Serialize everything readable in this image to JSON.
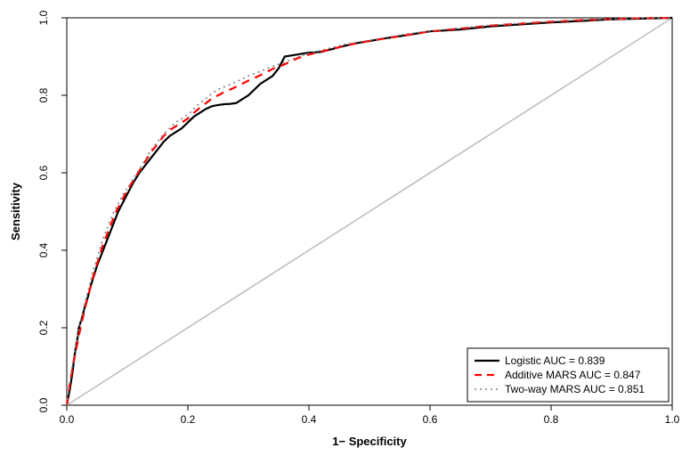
{
  "chart_data": {
    "type": "line",
    "title": "",
    "xlabel": "1− Specificity",
    "ylabel": "Sensitivity",
    "xlim": [
      0.0,
      1.0
    ],
    "ylim": [
      0.0,
      1.0
    ],
    "x_ticks": [
      0.0,
      0.2,
      0.4,
      0.6,
      0.8,
      1.0
    ],
    "y_ticks": [
      0.0,
      0.2,
      0.4,
      0.6,
      0.8,
      1.0
    ],
    "diagonal": {
      "x": [
        0.0,
        1.0
      ],
      "y": [
        0.0,
        1.0
      ]
    },
    "series": [
      {
        "name": "Logistic AUC = 0.839",
        "style": "solid",
        "color": "#000000",
        "x": [
          0.0,
          0.005,
          0.01,
          0.012,
          0.015,
          0.018,
          0.02,
          0.025,
          0.03,
          0.035,
          0.04,
          0.045,
          0.05,
          0.055,
          0.06,
          0.065,
          0.07,
          0.075,
          0.08,
          0.085,
          0.09,
          0.095,
          0.1,
          0.11,
          0.12,
          0.13,
          0.14,
          0.15,
          0.16,
          0.17,
          0.18,
          0.19,
          0.2,
          0.21,
          0.22,
          0.23,
          0.24,
          0.25,
          0.26,
          0.27,
          0.28,
          0.29,
          0.3,
          0.32,
          0.34,
          0.35,
          0.36,
          0.38,
          0.4,
          0.42,
          0.44,
          0.46,
          0.48,
          0.5,
          0.53,
          0.56,
          0.6,
          0.65,
          0.7,
          0.75,
          0.8,
          0.85,
          0.9,
          0.95,
          1.0
        ],
        "y": [
          0.0,
          0.04,
          0.09,
          0.12,
          0.15,
          0.175,
          0.2,
          0.225,
          0.255,
          0.28,
          0.31,
          0.335,
          0.36,
          0.38,
          0.4,
          0.42,
          0.44,
          0.46,
          0.48,
          0.5,
          0.515,
          0.53,
          0.545,
          0.575,
          0.6,
          0.62,
          0.64,
          0.66,
          0.68,
          0.695,
          0.705,
          0.715,
          0.73,
          0.745,
          0.755,
          0.765,
          0.772,
          0.775,
          0.777,
          0.778,
          0.78,
          0.79,
          0.8,
          0.83,
          0.85,
          0.87,
          0.9,
          0.905,
          0.91,
          0.912,
          0.92,
          0.928,
          0.935,
          0.94,
          0.948,
          0.955,
          0.965,
          0.97,
          0.978,
          0.983,
          0.988,
          0.992,
          0.996,
          0.998,
          1.0
        ]
      },
      {
        "name": "Additive MARS AUC = 0.847",
        "style": "dashed",
        "color": "#ff0000",
        "x": [
          0.0,
          0.005,
          0.01,
          0.015,
          0.02,
          0.025,
          0.03,
          0.035,
          0.04,
          0.045,
          0.05,
          0.055,
          0.06,
          0.065,
          0.07,
          0.075,
          0.08,
          0.085,
          0.09,
          0.095,
          0.1,
          0.11,
          0.12,
          0.13,
          0.14,
          0.15,
          0.16,
          0.17,
          0.18,
          0.19,
          0.2,
          0.21,
          0.22,
          0.23,
          0.24,
          0.25,
          0.26,
          0.27,
          0.28,
          0.29,
          0.3,
          0.32,
          0.34,
          0.36,
          0.38,
          0.4,
          0.42,
          0.44,
          0.46,
          0.48,
          0.5,
          0.53,
          0.56,
          0.6,
          0.65,
          0.7,
          0.75,
          0.8,
          0.85,
          0.9,
          0.95,
          1.0
        ],
        "y": [
          0.0,
          0.055,
          0.1,
          0.14,
          0.18,
          0.215,
          0.25,
          0.28,
          0.31,
          0.34,
          0.365,
          0.39,
          0.415,
          0.435,
          0.455,
          0.475,
          0.495,
          0.51,
          0.525,
          0.54,
          0.555,
          0.58,
          0.605,
          0.63,
          0.655,
          0.675,
          0.695,
          0.71,
          0.72,
          0.73,
          0.74,
          0.755,
          0.768,
          0.78,
          0.792,
          0.8,
          0.808,
          0.815,
          0.822,
          0.83,
          0.838,
          0.852,
          0.868,
          0.88,
          0.895,
          0.905,
          0.913,
          0.92,
          0.928,
          0.935,
          0.94,
          0.948,
          0.955,
          0.965,
          0.972,
          0.98,
          0.985,
          0.99,
          0.994,
          0.997,
          0.999,
          1.0
        ]
      },
      {
        "name": "Two-way MARS AUC = 0.851",
        "style": "dotted",
        "color": "#808080",
        "x": [
          0.0,
          0.005,
          0.01,
          0.015,
          0.02,
          0.025,
          0.03,
          0.035,
          0.04,
          0.045,
          0.05,
          0.055,
          0.06,
          0.065,
          0.07,
          0.075,
          0.08,
          0.085,
          0.09,
          0.095,
          0.1,
          0.11,
          0.12,
          0.13,
          0.14,
          0.15,
          0.16,
          0.17,
          0.18,
          0.19,
          0.2,
          0.21,
          0.22,
          0.23,
          0.24,
          0.25,
          0.26,
          0.27,
          0.28,
          0.3,
          0.32,
          0.34,
          0.36,
          0.38,
          0.4,
          0.42,
          0.44,
          0.46,
          0.48,
          0.5,
          0.53,
          0.56,
          0.6,
          0.65,
          0.7,
          0.75,
          0.8,
          0.85,
          0.9,
          0.95,
          1.0
        ],
        "y": [
          0.0,
          0.06,
          0.11,
          0.155,
          0.195,
          0.23,
          0.265,
          0.295,
          0.325,
          0.355,
          0.38,
          0.405,
          0.43,
          0.45,
          0.47,
          0.49,
          0.505,
          0.52,
          0.535,
          0.55,
          0.56,
          0.585,
          0.61,
          0.635,
          0.66,
          0.68,
          0.7,
          0.715,
          0.73,
          0.74,
          0.75,
          0.765,
          0.78,
          0.792,
          0.805,
          0.815,
          0.822,
          0.828,
          0.835,
          0.85,
          0.862,
          0.875,
          0.885,
          0.898,
          0.908,
          0.916,
          0.924,
          0.932,
          0.937,
          0.942,
          0.95,
          0.958,
          0.966,
          0.974,
          0.981,
          0.986,
          0.991,
          0.995,
          0.997,
          0.999,
          1.0
        ]
      }
    ],
    "legend": {
      "position": "bottom-right",
      "entries": [
        {
          "label": "Logistic AUC = 0.839",
          "color": "#000000",
          "style": "solid"
        },
        {
          "label": "Additive MARS AUC = 0.847",
          "color": "#ff0000",
          "style": "dashed"
        },
        {
          "label": "Two-way MARS AUC = 0.851",
          "color": "#808080",
          "style": "dotted"
        }
      ]
    }
  },
  "x_tick_labels": [
    "0.0",
    "0.2",
    "0.4",
    "0.6",
    "0.8",
    "1.0"
  ],
  "y_tick_labels": [
    "0.0",
    "0.2",
    "0.4",
    "0.6",
    "0.8",
    "1.0"
  ]
}
